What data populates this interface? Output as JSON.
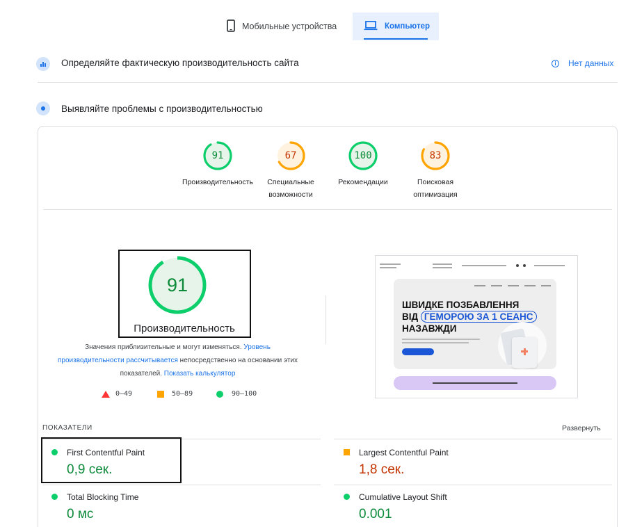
{
  "tabs": [
    {
      "label": "Мобильные устройства",
      "icon": "smartphone-icon",
      "active": false
    },
    {
      "label": "Компьютер",
      "icon": "laptop-icon",
      "active": true
    }
  ],
  "field_section": {
    "title": "Определяйте фактическую производительность сайта",
    "no_data": "Нет данных"
  },
  "lab_section": {
    "title": "Выявляйте проблемы с производительностью"
  },
  "categories": [
    {
      "score": "91",
      "label": "Производительность",
      "color": "#0c8a3a",
      "ring": "#0cce6b",
      "bg": "#e6f4ea",
      "fraction": 0.91
    },
    {
      "score": "67",
      "label": "Специальные возможности",
      "color": "#c33300",
      "ring": "#ffa400",
      "bg": "#fff3e0",
      "fraction": 0.67
    },
    {
      "score": "100",
      "label": "Рекомендации",
      "color": "#0c8a3a",
      "ring": "#0cce6b",
      "bg": "#e6f4ea",
      "fraction": 1.0
    },
    {
      "score": "83",
      "label": "Поисковая оптимизация",
      "color": "#c33300",
      "ring": "#ffa400",
      "bg": "#fff3e0",
      "fraction": 0.83
    }
  ],
  "big_score": {
    "score": "91",
    "label": "Производительность",
    "fraction": 0.91
  },
  "note": {
    "part1": "Значения приблизительные и могут изменяться. ",
    "link1": "Уровень производительности рассчитывается",
    "part2": " непосредственно на основании этих показателей. ",
    "link2": "Показать калькулятор"
  },
  "legend": {
    "fail": "0–49",
    "average": "50–89",
    "pass": "90–100"
  },
  "metrics_header": {
    "title": "ПОКАЗАТЕЛИ",
    "expand": "Развернуть"
  },
  "metrics": [
    {
      "name": "First Contentful Paint",
      "value": "0,9 сек.",
      "status": "pass"
    },
    {
      "name": "Largest Contentful Paint",
      "value": "1,8 сек.",
      "status": "average"
    },
    {
      "name": "Total Blocking Time",
      "value": "0 мс",
      "status": "pass"
    },
    {
      "name": "Cumulative Layout Shift",
      "value": "0.001",
      "status": "pass"
    }
  ],
  "colors": {
    "pass": "#0cce6b",
    "pass_text": "#0c8a3a",
    "average": "#ffa400",
    "average_text": "#c33300",
    "fail": "#ff3333",
    "accent": "#1a73e8"
  },
  "preview": {
    "headline1": "ШВИДКЕ ПОЗБАВЛЕННЯ",
    "headline2_prefix": "ВІД",
    "headline2_highlight": "ГЕМОРОЮ ЗА 1 СЕАНС",
    "headline3": "НАЗАВЖДИ"
  }
}
